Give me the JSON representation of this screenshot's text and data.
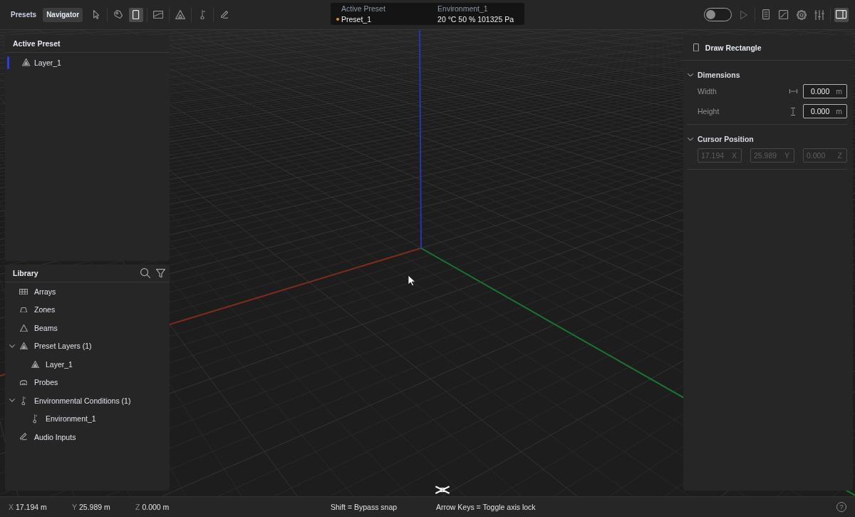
{
  "toolbar": {
    "tabs": [
      {
        "label": "Presets",
        "selected": false
      },
      {
        "label": "Navigator",
        "selected": true
      }
    ],
    "tool_groups": [
      [
        {
          "kind": "select",
          "selected": false
        }
      ],
      [
        {
          "kind": "annotate",
          "selected": false
        },
        {
          "kind": "rectangle",
          "selected": true
        }
      ],
      [
        {
          "kind": "surface",
          "selected": false
        }
      ],
      [
        {
          "kind": "beam",
          "selected": false
        }
      ],
      [
        {
          "kind": "environment",
          "selected": false
        }
      ],
      [
        {
          "kind": "audio",
          "selected": false
        }
      ]
    ],
    "status": {
      "preset_label": "Active Preset",
      "environment_label": "Environment_1",
      "preset": "Preset_1",
      "conditions": "20 °C 50 % 101325 Pa"
    },
    "simulation": {
      "on": false
    },
    "play": {
      "disabled": true
    },
    "view_tool_groups": [
      [
        {
          "kind": "list",
          "selected": false
        },
        {
          "kind": "chart",
          "selected": false
        },
        {
          "kind": "settings",
          "selected": false
        },
        {
          "kind": "sliders",
          "selected": false
        }
      ],
      [
        {
          "kind": "panel",
          "selected": true
        }
      ]
    ]
  },
  "active_preset": {
    "title": "Active Preset",
    "layers": [
      {
        "label": "Layer_1",
        "color": "#2b3ee0",
        "selected": false
      }
    ]
  },
  "library": {
    "title": "Library",
    "items": [
      {
        "label": "Arrays",
        "kind": "array",
        "selected": false
      },
      {
        "label": "Zones",
        "kind": "zone",
        "selected": false
      },
      {
        "label": "Beams",
        "kind": "beam",
        "selected": false
      },
      {
        "label": "Preset Layers (1)",
        "kind": "layer",
        "selected": false,
        "expanded": true,
        "children": [
          {
            "label": "Layer_1",
            "kind": "layer",
            "selected": false
          }
        ]
      },
      {
        "label": "Probes",
        "kind": "probe",
        "selected": false
      },
      {
        "label": "Environmental Conditions (1)",
        "kind": "environment",
        "selected": false,
        "expanded": true,
        "children": [
          {
            "label": "Environment_1",
            "kind": "environment",
            "selected": false
          }
        ]
      },
      {
        "label": "Audio Inputs",
        "kind": "audio",
        "selected": false
      }
    ]
  },
  "properties": {
    "title": "Draw Rectangle",
    "dimensions": {
      "title": "Dimensions",
      "expanded": true,
      "rows": [
        {
          "kind": "width",
          "label": "Width",
          "value": "0.000",
          "unit": "m"
        },
        {
          "kind": "height",
          "label": "Height",
          "value": "0.000",
          "unit": "m"
        }
      ]
    },
    "cursor_position": {
      "title": "Cursor Position",
      "expanded": true,
      "fields": [
        {
          "value": "17.194",
          "axis": "X",
          "disabled": true
        },
        {
          "value": "25.989",
          "axis": "Y",
          "disabled": true
        },
        {
          "value": "0.000",
          "axis": "Z",
          "disabled": true
        }
      ]
    }
  },
  "status_bar": {
    "coordinates": [
      {
        "axis": "X",
        "value": "17.194 m"
      },
      {
        "axis": "Y",
        "value": "25.989 m"
      },
      {
        "axis": "Z",
        "value": "0.000 m"
      }
    ],
    "hints": [
      "Shift = Bypass snap",
      "Arrow Keys = Toggle axis lock"
    ],
    "help": "?"
  }
}
